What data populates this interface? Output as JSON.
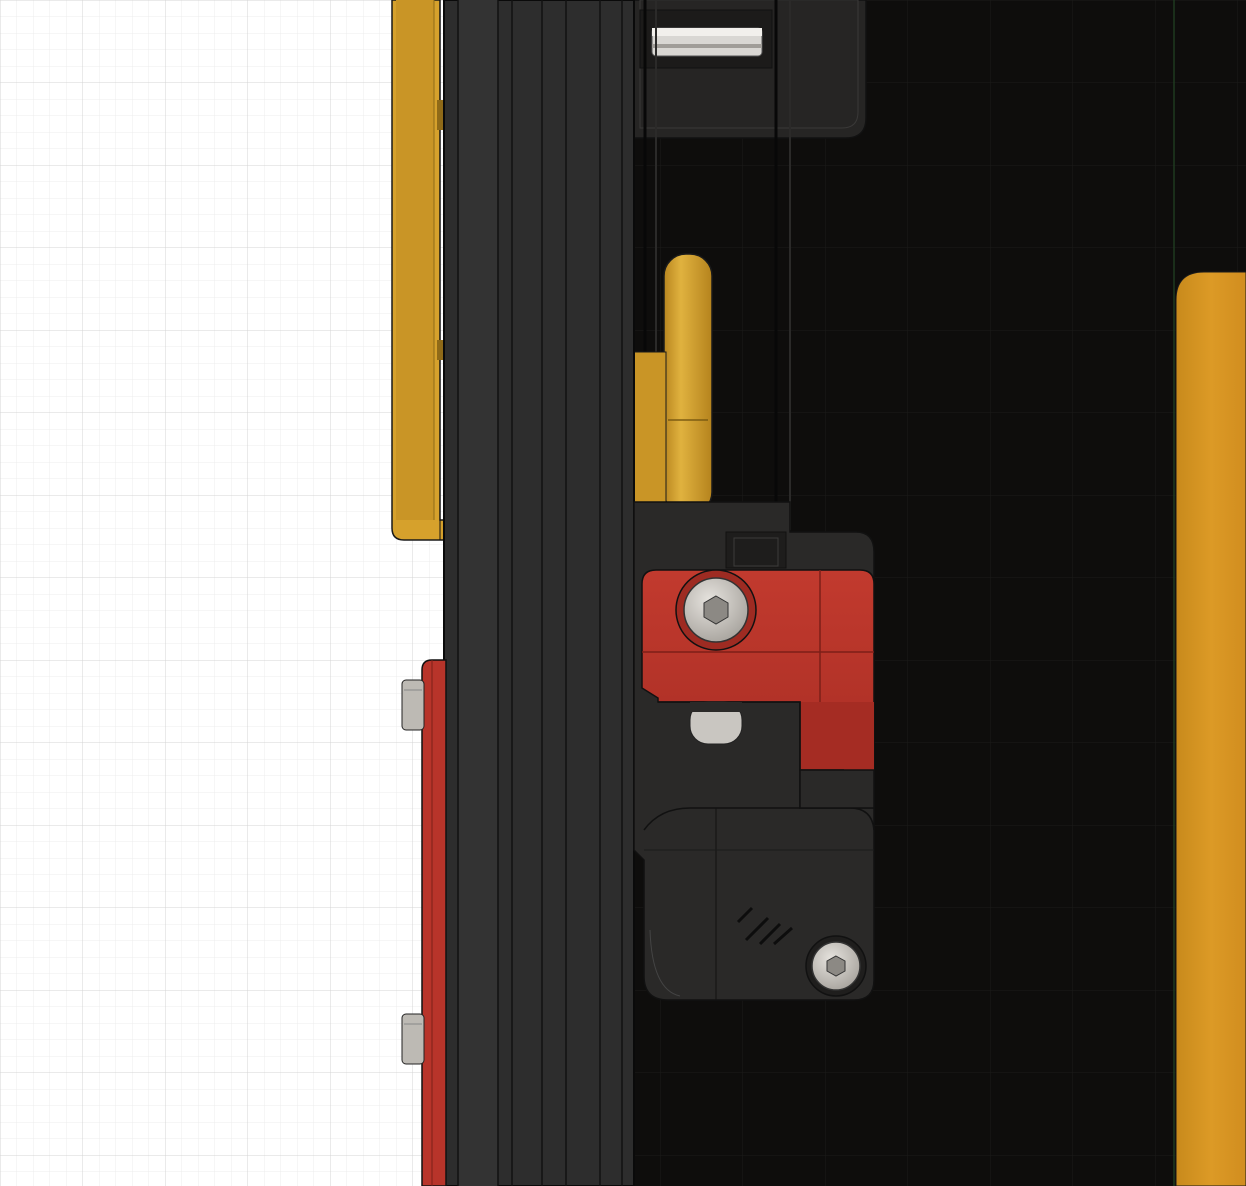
{
  "viewport": {
    "label": "",
    "background_color": "#ffffff",
    "grid_minor_color": "#e6e6e6",
    "grid_major_color": "#cfcfcf",
    "dark_background_color": "#0e0d0c",
    "dark_grid_color": "#1b1a19"
  },
  "materials": {
    "frame_extrusion": "#2c2c2c",
    "printed_black": "#2a2928",
    "printed_red": "#b8342a",
    "printed_red_shade": "#8d2720",
    "yellow_part": "#d6a12c",
    "yellow_shade": "#a87a1c",
    "orange_panel": "#d8921f",
    "bolt_steel": "#c9c6c1",
    "edge_line": "#111111"
  },
  "icons": {
    "voron_logo": "voron-logo-icon",
    "socket_head_screw": "socket-head-screw-icon",
    "button_head_screw": "button-head-screw-icon"
  }
}
